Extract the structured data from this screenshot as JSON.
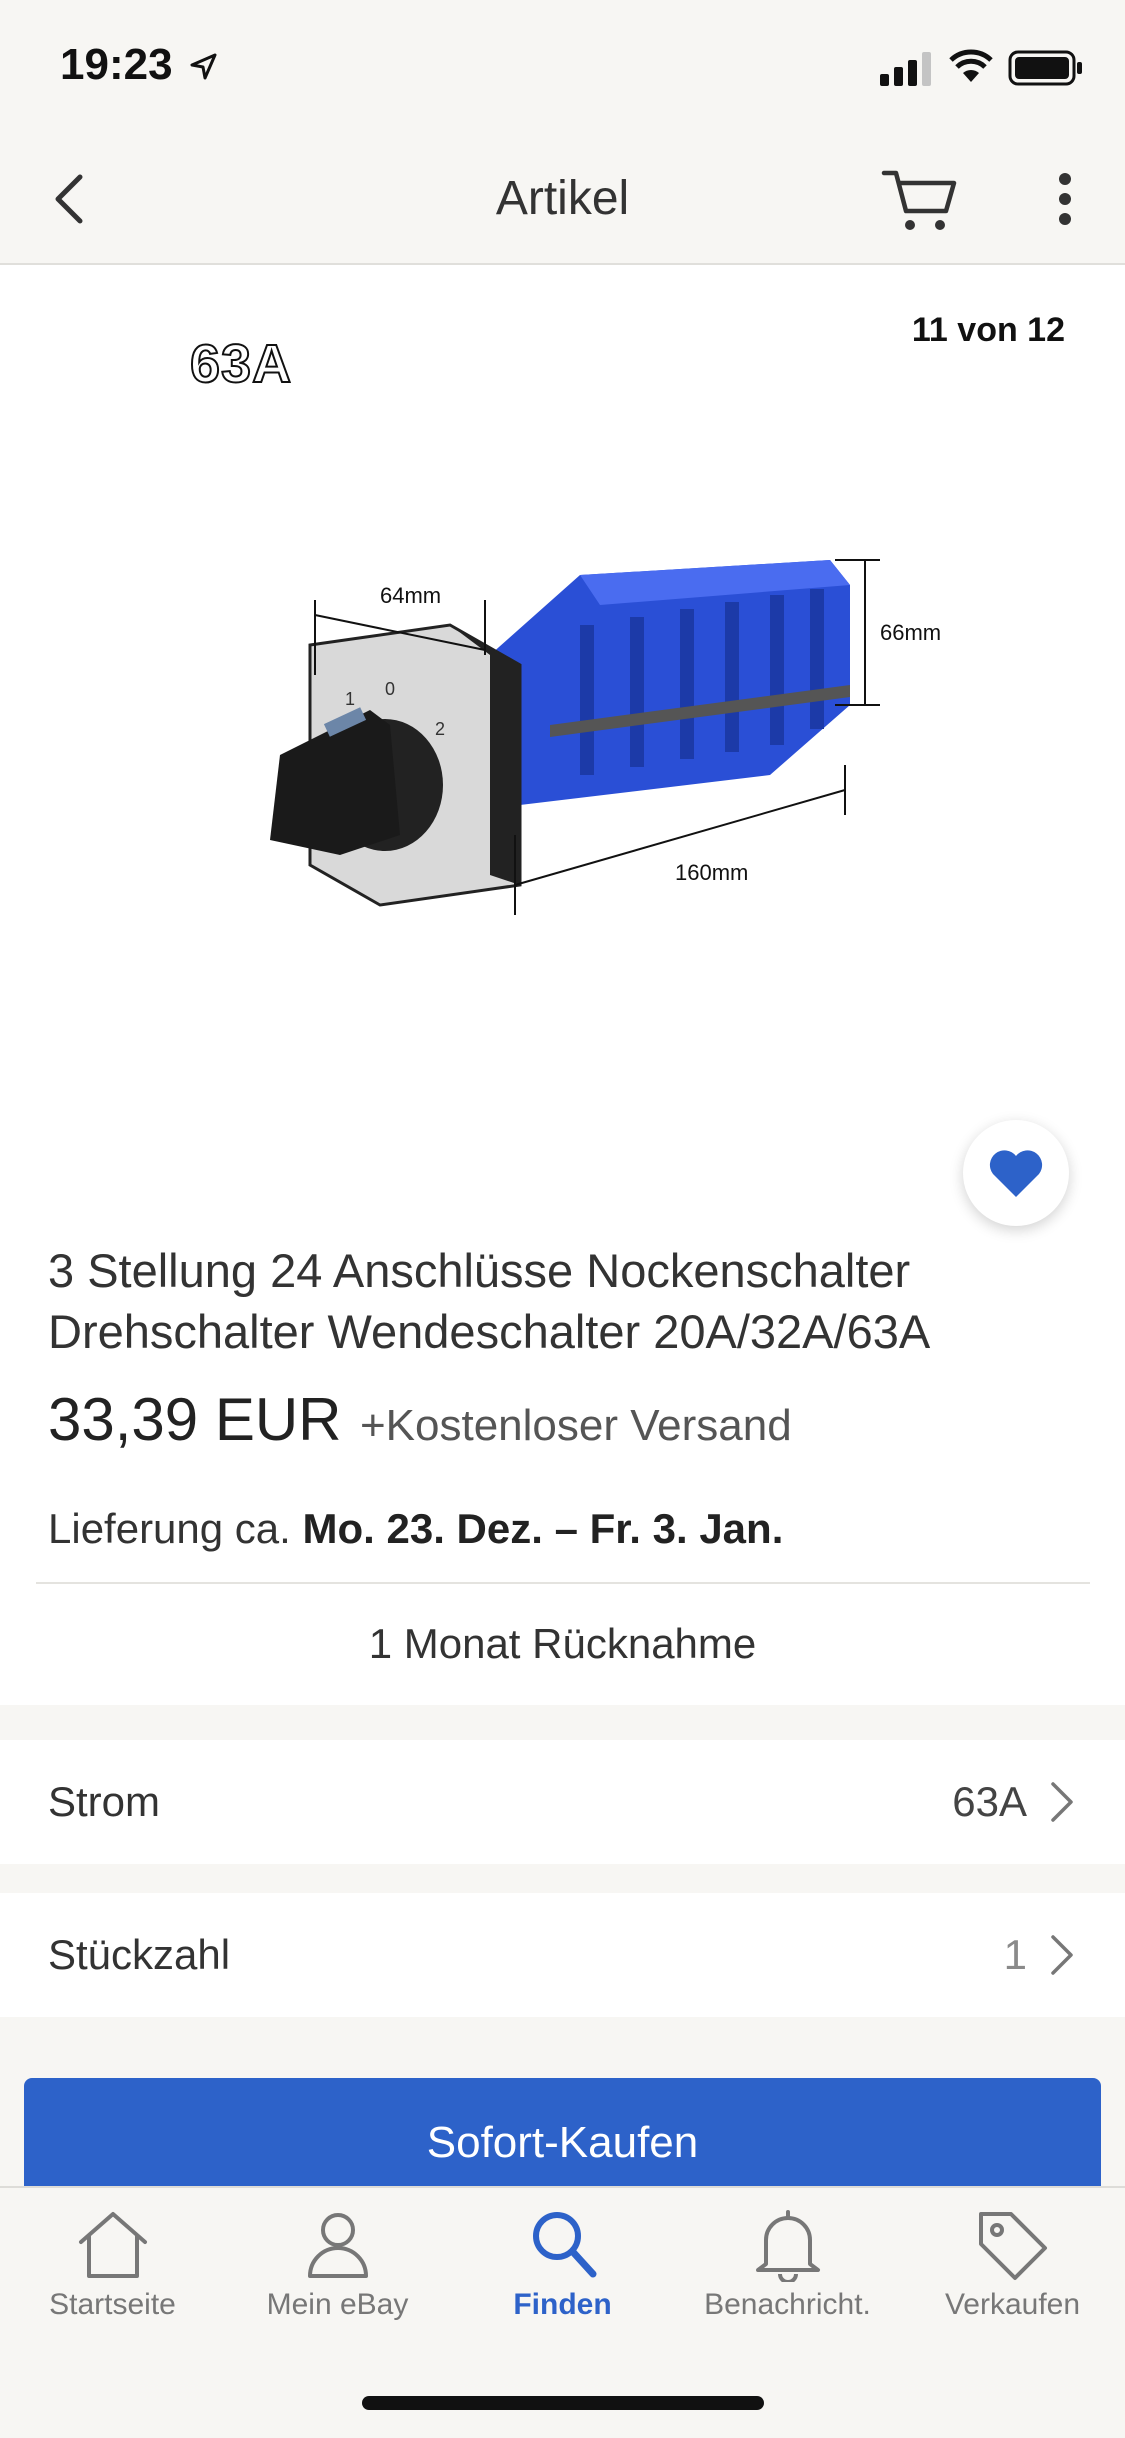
{
  "status_bar": {
    "time": "19:23"
  },
  "nav": {
    "title": "Artikel"
  },
  "gallery": {
    "counter": "11 von 12",
    "image_label": "63A",
    "dimensions": {
      "width": "64mm",
      "height": "66mm",
      "length": "160mm"
    },
    "dial_marks": [
      "1",
      "0",
      "2"
    ]
  },
  "product": {
    "title": "3 Stellung 24 Anschlüsse Nockenschalter Drehschalter Wendeschalter 20A/32A/63A",
    "price": "33,39 EUR",
    "shipping": "+Kostenloser Versand",
    "delivery_prefix": "Lieferung ca.",
    "delivery_dates": "Mo. 23. Dez. – Fr. 3. Jan.",
    "returns": "1 Monat Rücknahme"
  },
  "options": [
    {
      "label": "Strom",
      "value": "63A"
    },
    {
      "label": "Stückzahl",
      "value": "1"
    }
  ],
  "buy_button": "Sofort-Kaufen",
  "tabs": [
    {
      "label": "Startseite",
      "icon": "home-icon"
    },
    {
      "label": "Mein eBay",
      "icon": "person-icon"
    },
    {
      "label": "Finden",
      "icon": "search-icon",
      "active": true
    },
    {
      "label": "Benachricht.",
      "icon": "bell-icon"
    },
    {
      "label": "Verkaufen",
      "icon": "tag-icon"
    }
  ],
  "colors": {
    "accent": "#2d62c9",
    "product_blue": "#2a4fd6",
    "background": "#f7f6f3"
  }
}
